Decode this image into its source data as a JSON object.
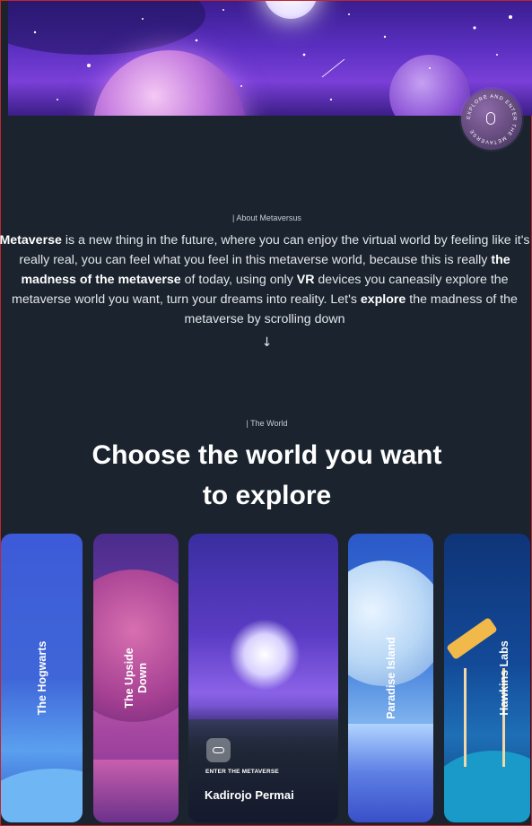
{
  "hero": {
    "badge_text": "EXPLORE AND ENTER THE METAVERSE"
  },
  "about": {
    "tag": "| About Metaversus",
    "parts": {
      "p1": "Metaverse",
      "p2": " is a new thing in the future, where you can enjoy the virtual world by feeling like it's really real, you can feel what you feel in this metaverse world, because this is really ",
      "p3": "the madness of the metaverse",
      "p4": " of today, using only ",
      "p5": "VR",
      "p6": " devices you caneasily explore the metaverse world you want, turn your dreams into reality. Let's ",
      "p7": "explore",
      "p8": " the madness of the metaverse by scrolling down"
    },
    "arrow": "↓"
  },
  "world": {
    "tag": "| The World",
    "title": "Choose the world you want to explore"
  },
  "cards": [
    {
      "label": "The Hogwarts"
    },
    {
      "label": "The Upside Down"
    },
    {
      "enter": "ENTER THE METAVERSE",
      "label": "Kadirojo Permai"
    },
    {
      "label": "Paradise Island"
    },
    {
      "label": "Hawkins Labs"
    }
  ]
}
